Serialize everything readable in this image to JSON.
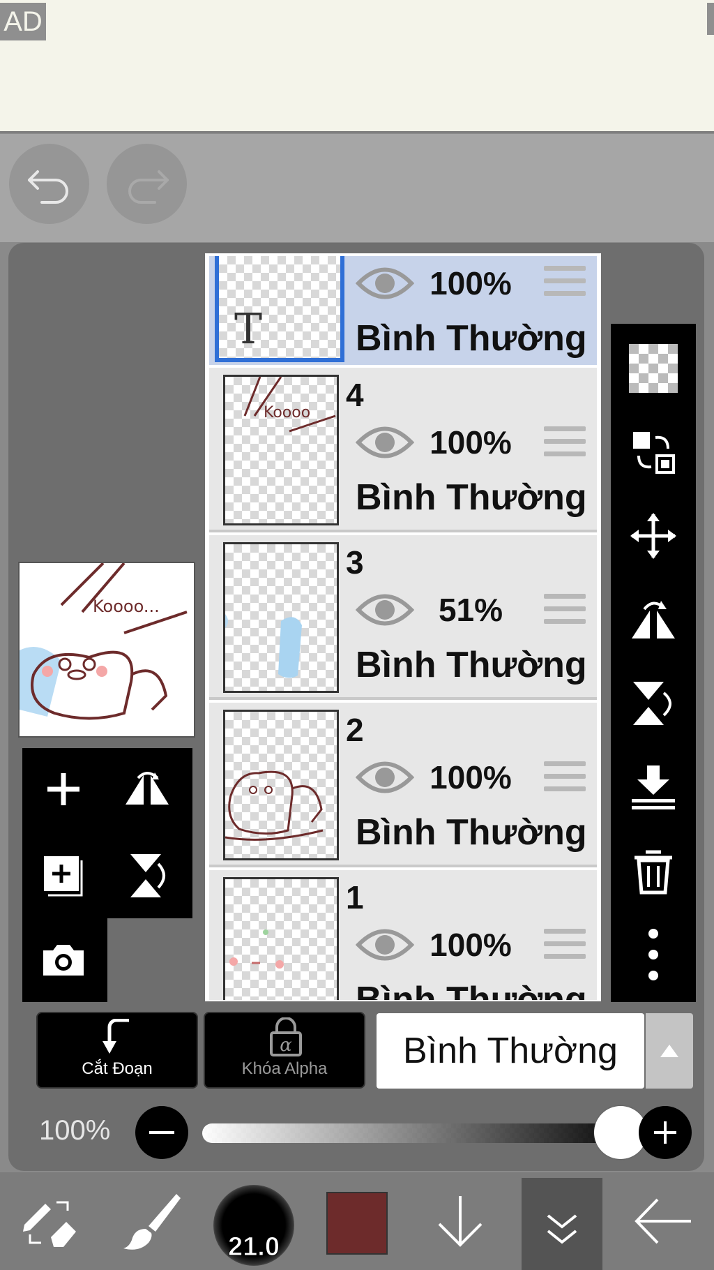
{
  "ad": {
    "label": "AD"
  },
  "layers": [
    {
      "num": "",
      "opacity": "100%",
      "blend": "Bình Thường",
      "selected": true
    },
    {
      "num": "4",
      "opacity": "100%",
      "blend": "Bình Thường"
    },
    {
      "num": "3",
      "opacity": "51%",
      "blend": "Bình Thường"
    },
    {
      "num": "2",
      "opacity": "100%",
      "blend": "Bình Thường"
    },
    {
      "num": "1",
      "opacity": "100%",
      "blend": "Bình Thường"
    }
  ],
  "text_layer_glyph": "T",
  "canvas_text": "Koooo...",
  "layer4_text": "Koooo",
  "buttons": {
    "clip_label": "Cắt Đoạn",
    "alpha_lock_label": "Khóa Alpha",
    "alpha_symbol": "α"
  },
  "blend_mode": {
    "value": "Bình Thường"
  },
  "opacity": {
    "label": "100%",
    "level": 1.0
  },
  "brush": {
    "size": "21.0",
    "color": "#6d2b2b"
  },
  "colors": {
    "selected_row": "#c7d3ea",
    "selection_border": "#2f6fd6",
    "panel": "#6e6e6e"
  }
}
